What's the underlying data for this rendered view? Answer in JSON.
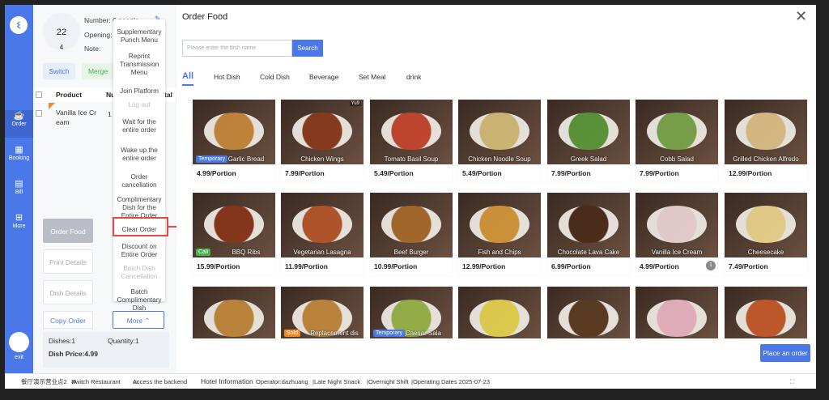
{
  "left": {
    "table": {
      "number": "22",
      "guests": "4"
    },
    "number_line": "Number: 6 people",
    "opening_label": "Opening:",
    "note_label": "Note:",
    "switch_label": "Switch",
    "merge_label": "Merge",
    "col_product": "Product",
    "col_num": "Num",
    "col_total": "tal",
    "item_name": "Vanilla Ice Cr eam",
    "item_qty": "1",
    "order_food": "Order Food",
    "print_details": "Print Details",
    "dish_details": "Dish Details",
    "copy_order": "Copy Order",
    "more": "More",
    "dishes": "Dishes:1",
    "quantity": "Quantity:1",
    "dish_price": "Dish Price:4.99"
  },
  "rail": [
    {
      "label": "Order",
      "icon": "cup-icon"
    },
    {
      "label": "Booking",
      "icon": "calendar-icon"
    },
    {
      "label": "Bill",
      "icon": "bill-icon"
    },
    {
      "label": "More",
      "icon": "grid-icon"
    }
  ],
  "rail_exit": "exit",
  "menu": [
    {
      "label": "Supplementary Punch Menu",
      "enabled": true
    },
    {
      "label": "Reprint Transmission Menu",
      "enabled": true
    },
    {
      "label": "Join Platform",
      "enabled": true
    },
    {
      "label": "Log out",
      "enabled": false
    },
    {
      "label": "Wait for the entire order",
      "enabled": true
    },
    {
      "label": "Wake up the entire order",
      "enabled": true
    },
    {
      "label": "Order cancellation",
      "enabled": true
    },
    {
      "label": "Complimentary Dish for the Entire Order",
      "enabled": true
    },
    {
      "label": "Clear Order",
      "enabled": true
    },
    {
      "label": "Discount on Entire Order",
      "enabled": true
    },
    {
      "label": "Batch Dish Cancellation",
      "enabled": false
    },
    {
      "label": "Batch Complimentary Dish",
      "enabled": true
    }
  ],
  "dialog": {
    "title": "Order Food",
    "search_placeholder": "Please enter the dish name",
    "search_button": "Search",
    "categories": [
      "All",
      "Hot Dish",
      "Cold Dish",
      "Beverage",
      "Set Meal",
      "drink"
    ],
    "place_order": "Place an order"
  },
  "dishes": [
    {
      "name": "Garlic Bread",
      "price": "4.99/Portion",
      "tag": "Temporary",
      "tag_color": "#4a78e8",
      "color": "#c98a3c"
    },
    {
      "name": "Chicken Wings",
      "price": "7.99/Portion",
      "yu": "Yu9",
      "color": "#8b3a1c"
    },
    {
      "name": "Tomato Basil Soup",
      "price": "5.49/Portion",
      "color": "#c9452e"
    },
    {
      "name": "Chicken Noodle Soup",
      "price": "5.49/Portion",
      "color": "#d8c07a"
    },
    {
      "name": "Greek Salad",
      "price": "7.99/Portion",
      "color": "#5a9a3a"
    },
    {
      "name": "Cobb Salad",
      "price": "7.99/Portion",
      "color": "#7aa84a"
    },
    {
      "name": "Grilled Chicken Alfredo",
      "price": "12.99/Portion",
      "color": "#e0c48a"
    },
    {
      "name": "BBQ Ribs",
      "price": "15.99/Portion",
      "tag": "Cali",
      "tag_color": "#4caf50",
      "color": "#8a3418"
    },
    {
      "name": "Vegetarian Lasagna",
      "price": "11.99/Portion",
      "color": "#b8562a"
    },
    {
      "name": "Beef Burger",
      "price": "10.99/Portion",
      "color": "#a86a2a"
    },
    {
      "name": "Fish and Chips",
      "price": "12.99/Portion",
      "color": "#d89a3a"
    },
    {
      "name": "Chocolate Lava Cake",
      "price": "6.99/Portion",
      "color": "#4a2a18"
    },
    {
      "name": "Vanilla Ice Cream",
      "price": "4.99/Portion",
      "badge": "1",
      "color": "#f0d8d8"
    },
    {
      "name": "Cheesecake",
      "price": "7.49/Portion",
      "color": "#f0d890"
    },
    {
      "name": "",
      "price": "",
      "color": "#c48a3c"
    },
    {
      "name": "Replacement dis",
      "price": "",
      "tag": "Sold",
      "tag_color": "#f08a24",
      "color": "#c48a3c"
    },
    {
      "name": "Caesar Sala",
      "price": "",
      "tag": "Temporary",
      "tag_color": "#4a78e8",
      "color": "#9ab84a"
    },
    {
      "name": "",
      "price": "",
      "color": "#e8d850"
    },
    {
      "name": "",
      "price": "",
      "color": "#5a3a20"
    },
    {
      "name": "",
      "price": "",
      "color": "#f0b8c8"
    },
    {
      "name": "",
      "price": "",
      "color": "#c85a2a"
    }
  ],
  "status": {
    "store": "餐厅演示营业点2",
    "switch_restaurant": "Switch Restaurant",
    "access_backend": "Access the backend",
    "hotel_info": "Hotel Information",
    "operator": "Operator:dazhuang",
    "shift": "Late Night Snack",
    "overnight": "Overnight Shift",
    "operating_dates": "Operating Dates 2025-07-23"
  }
}
